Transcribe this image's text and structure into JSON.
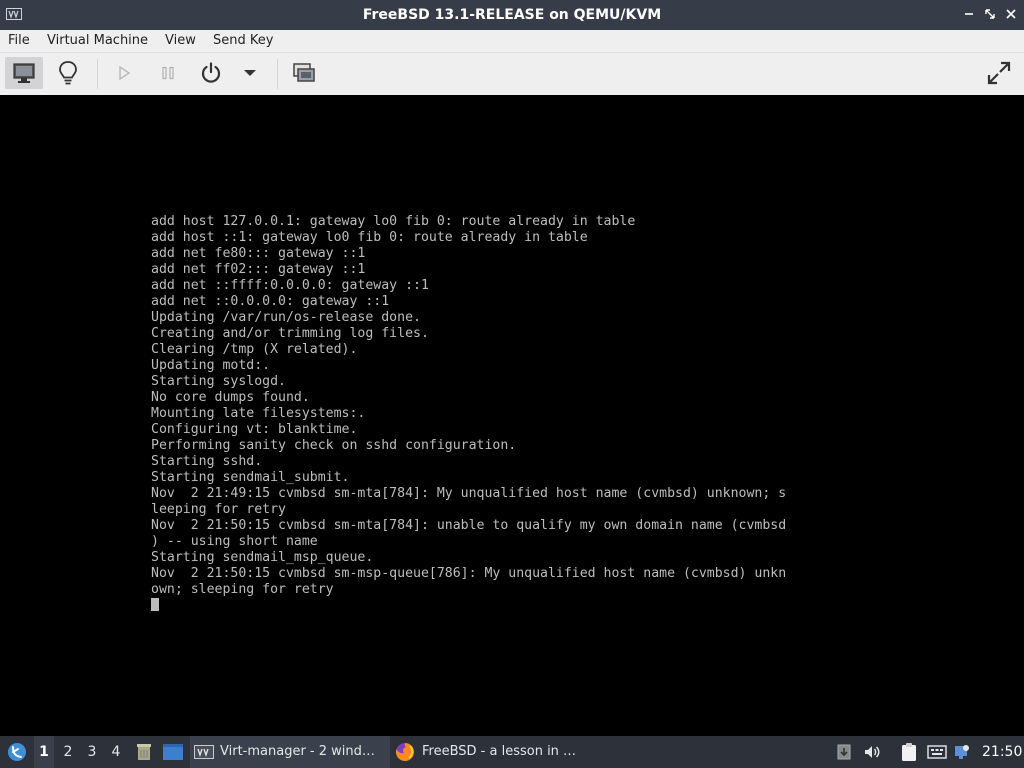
{
  "window": {
    "title": "FreeBSD 13.1-RELEASE on QEMU/KVM"
  },
  "menu": {
    "items": [
      "File",
      "Virtual Machine",
      "View",
      "Send Key"
    ]
  },
  "toolbar": {
    "buttons": [
      {
        "name": "console-view",
        "icon": "monitor-icon"
      },
      {
        "name": "details-view",
        "icon": "lightbulb-icon"
      },
      {
        "name": "run",
        "icon": "play-icon"
      },
      {
        "name": "pause",
        "icon": "pause-icon"
      },
      {
        "name": "shutdown",
        "icon": "power-icon"
      },
      {
        "name": "shutdown-menu",
        "icon": "chevron-down-icon"
      },
      {
        "name": "snapshots",
        "icon": "snapshot-icon"
      },
      {
        "name": "fullscreen",
        "icon": "fullscreen-icon"
      }
    ]
  },
  "console": {
    "lines": [
      "add host 127.0.0.1: gateway lo0 fib 0: route already in table",
      "add host ::1: gateway lo0 fib 0: route already in table",
      "add net fe80::: gateway ::1",
      "add net ff02::: gateway ::1",
      "add net ::ffff:0.0.0.0: gateway ::1",
      "add net ::0.0.0.0: gateway ::1",
      "Updating /var/run/os-release done.",
      "Creating and/or trimming log files.",
      "Clearing /tmp (X related).",
      "Updating motd:.",
      "Starting syslogd.",
      "No core dumps found.",
      "Mounting late filesystems:.",
      "Configuring vt: blanktime.",
      "Performing sanity check on sshd configuration.",
      "Starting sshd.",
      "Starting sendmail_submit.",
      "Nov  2 21:49:15 cvmbsd sm-mta[784]: My unqualified host name (cvmbsd) unknown; s",
      "leeping for retry",
      "Nov  2 21:50:15 cvmbsd sm-mta[784]: unable to qualify my own domain name (cvmbsd",
      ") -- using short name",
      "Starting sendmail_msp_queue.",
      "Nov  2 21:50:15 cvmbsd sm-msp-queue[786]: My unqualified host name (cvmbsd) unkn",
      "own; sleeping for retry"
    ]
  },
  "taskbar": {
    "workspaces": [
      "1",
      "2",
      "3",
      "4"
    ],
    "active_workspace": "1",
    "tasks": [
      {
        "label": "Virt-manager - 2 wind…",
        "icon": "virt-manager-icon"
      },
      {
        "label": "FreeBSD - a lesson in …",
        "icon": "firefox-icon"
      }
    ],
    "clock": "21:50"
  },
  "colors": {
    "titlebar": "#373d48",
    "menubar": "#efeff0",
    "console_bg": "#000000",
    "console_text": "#bdbdbd",
    "taskbar": "#2c313a"
  }
}
